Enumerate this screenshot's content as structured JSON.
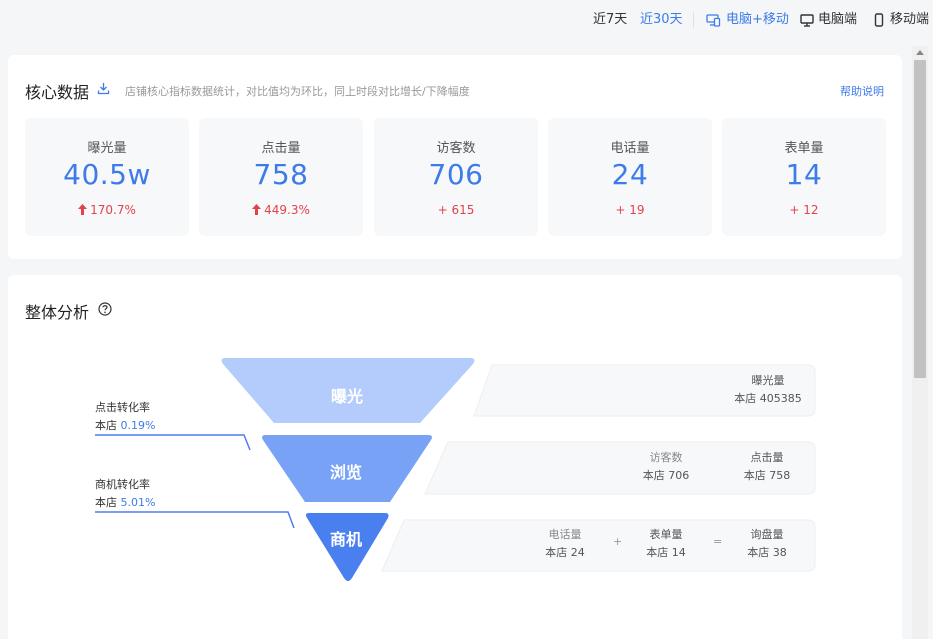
{
  "topbar": {
    "range_7": "近7天",
    "range_30": "近30天",
    "device_all": "电脑+移动",
    "device_pc": "电脑端",
    "device_mobile": "移动端"
  },
  "core": {
    "title": "核心数据",
    "subtitle": "店铺核心指标数据统计，对比值均为环比，同上时段对比增长/下降幅度",
    "help": "帮助说明",
    "metrics": [
      {
        "label": "曝光量",
        "value": "40.5w",
        "change": "170.7%",
        "arrow": true
      },
      {
        "label": "点击量",
        "value": "758",
        "change": "449.3%",
        "arrow": true
      },
      {
        "label": "访客数",
        "value": "706",
        "change": "+ 615",
        "arrow": false
      },
      {
        "label": "电话量",
        "value": "24",
        "change": "+ 19",
        "arrow": false
      },
      {
        "label": "表单量",
        "value": "14",
        "change": "+ 12",
        "arrow": false
      }
    ]
  },
  "analysis": {
    "title": "整体分析",
    "click_rate": {
      "label": "点击转化率",
      "prefix": "本店",
      "value": "0.19%"
    },
    "biz_rate": {
      "label": "商机转化率",
      "prefix": "本店",
      "value": "5.01%"
    },
    "stages": [
      "曝光",
      "浏览",
      "商机"
    ],
    "row1": {
      "name": "曝光量",
      "value": "本店 405385"
    },
    "row2": [
      {
        "name": "访客数",
        "value": "本店 706"
      },
      {
        "name": "点击量",
        "value": "本店 758"
      }
    ],
    "row3": [
      {
        "name": "电话量",
        "value": "本店 24"
      },
      {
        "name": "表单量",
        "value": "本店 14"
      },
      {
        "name": "询盘量",
        "value": "本店 38"
      }
    ],
    "op_plus": "+",
    "op_eq": "="
  },
  "colors": {
    "accent": "#3d7be8",
    "down": "#e2434b",
    "stage1": "#b3ccfb",
    "stage2": "#78a2f6",
    "stage3": "#4a7ff0"
  }
}
